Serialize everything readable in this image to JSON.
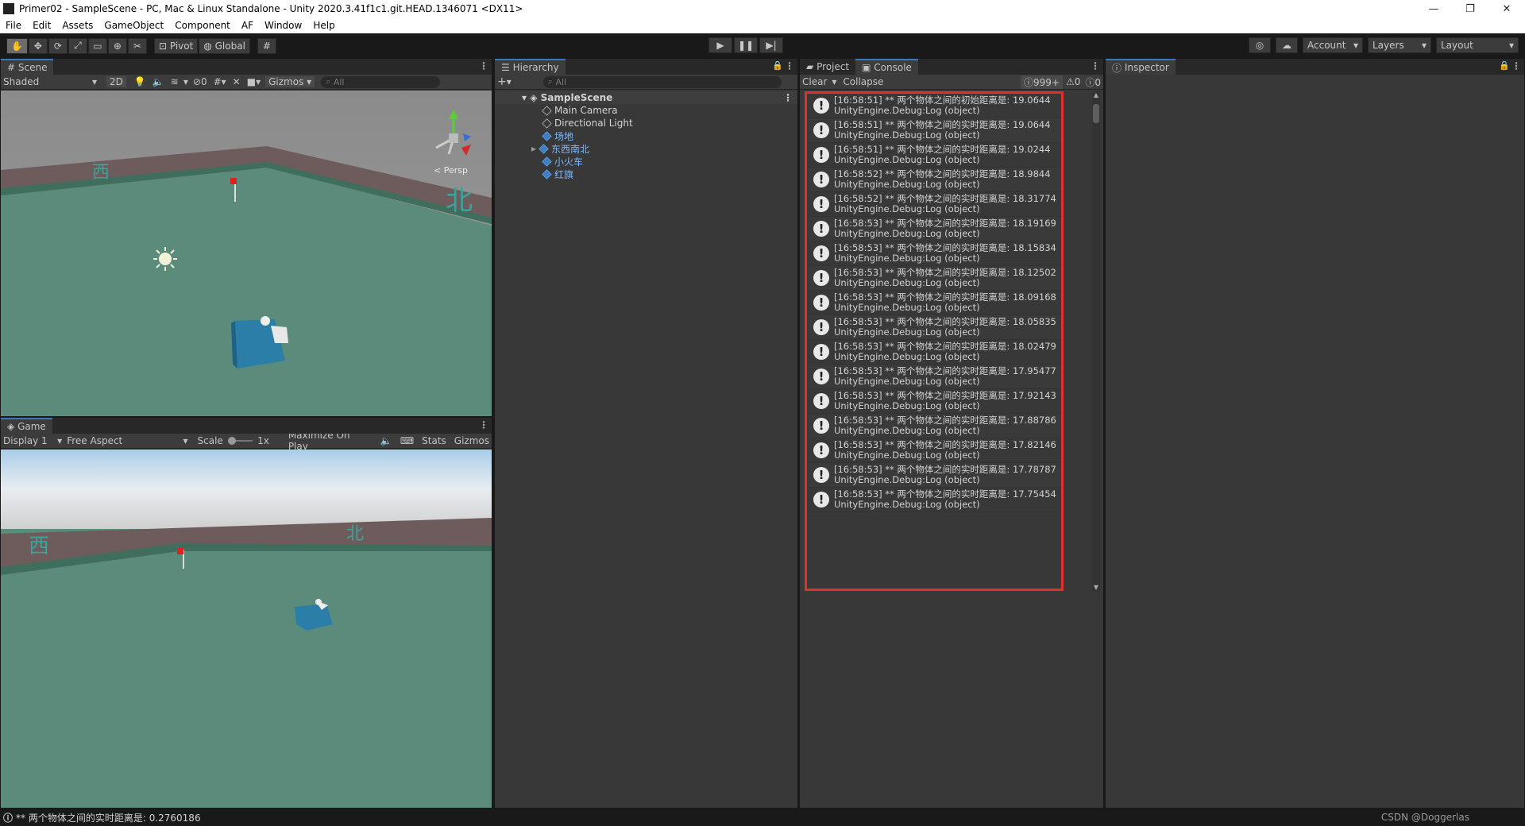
{
  "window": {
    "title": "Primer02 - SampleScene - PC, Mac & Linux Standalone - Unity 2020.3.41f1c1.git.HEAD.1346071 <DX11>",
    "minimize": "—",
    "maximize": "❐",
    "close": "✕"
  },
  "menu": [
    "File",
    "Edit",
    "Assets",
    "GameObject",
    "Component",
    "AF",
    "Window",
    "Help"
  ],
  "toolbar": {
    "pivot": "Pivot",
    "global": "Global",
    "account": "Account",
    "layers": "Layers",
    "layout": "Layout",
    "play_icon": "play-icon",
    "pause_icon": "pause-icon",
    "step_icon": "step-icon"
  },
  "scene": {
    "tab": "Scene",
    "shading": "Shaded",
    "mode_2d": "2D",
    "hidden_count": "0",
    "gizmos": "Gizmos",
    "search_placeholder": "All",
    "persp": "< Persp",
    "label_west": "西",
    "label_north": "北"
  },
  "game": {
    "tab": "Game",
    "display": "Display 1",
    "aspect": "Free Aspect",
    "scale_label": "Scale",
    "scale_value": "1x",
    "maximize": "Maximize On Play",
    "stats": "Stats",
    "gizmos": "Gizmos",
    "label_west": "西",
    "label_north": "北"
  },
  "hierarchy": {
    "tab": "Hierarchy",
    "search_placeholder": "All",
    "scene": "SampleScene",
    "items": [
      {
        "label": "Main Camera",
        "prefab": false
      },
      {
        "label": "Directional Light",
        "prefab": false
      },
      {
        "label": "场地",
        "prefab": true
      },
      {
        "label": "东西南北",
        "prefab": true
      },
      {
        "label": "小火车",
        "prefab": true
      },
      {
        "label": "红旗",
        "prefab": true
      }
    ]
  },
  "console": {
    "project_tab": "Project",
    "console_tab": "Console",
    "clear": "Clear",
    "collapse": "Collapse",
    "log_count": "999+",
    "warn_count": "0",
    "error_count": "0",
    "entries": [
      {
        "line1": "[16:58:51] ** 两个物体之间的初始距离是: 19.0644",
        "line2": "UnityEngine.Debug:Log (object)"
      },
      {
        "line1": "[16:58:51] ** 两个物体之间的实时距离是: 19.0644",
        "line2": "UnityEngine.Debug:Log (object)"
      },
      {
        "line1": "[16:58:51] ** 两个物体之间的实时距离是: 19.0244",
        "line2": "UnityEngine.Debug:Log (object)"
      },
      {
        "line1": "[16:58:52] ** 两个物体之间的实时距离是: 18.9844",
        "line2": "UnityEngine.Debug:Log (object)"
      },
      {
        "line1": "[16:58:52] ** 两个物体之间的实时距离是: 18.31774",
        "line2": "UnityEngine.Debug:Log (object)"
      },
      {
        "line1": "[16:58:53] ** 两个物体之间的实时距离是: 18.19169",
        "line2": "UnityEngine.Debug:Log (object)"
      },
      {
        "line1": "[16:58:53] ** 两个物体之间的实时距离是: 18.15834",
        "line2": "UnityEngine.Debug:Log (object)"
      },
      {
        "line1": "[16:58:53] ** 两个物体之间的实时距离是: 18.12502",
        "line2": "UnityEngine.Debug:Log (object)"
      },
      {
        "line1": "[16:58:53] ** 两个物体之间的实时距离是: 18.09168",
        "line2": "UnityEngine.Debug:Log (object)"
      },
      {
        "line1": "[16:58:53] ** 两个物体之间的实时距离是: 18.05835",
        "line2": "UnityEngine.Debug:Log (object)"
      },
      {
        "line1": "[16:58:53] ** 两个物体之间的实时距离是: 18.02479",
        "line2": "UnityEngine.Debug:Log (object)"
      },
      {
        "line1": "[16:58:53] ** 两个物体之间的实时距离是: 17.95477",
        "line2": "UnityEngine.Debug:Log (object)"
      },
      {
        "line1": "[16:58:53] ** 两个物体之间的实时距离是: 17.92143",
        "line2": "UnityEngine.Debug:Log (object)"
      },
      {
        "line1": "[16:58:53] ** 两个物体之间的实时距离是: 17.88786",
        "line2": "UnityEngine.Debug:Log (object)"
      },
      {
        "line1": "[16:58:53] ** 两个物体之间的实时距离是: 17.82146",
        "line2": "UnityEngine.Debug:Log (object)"
      },
      {
        "line1": "[16:58:53] ** 两个物体之间的实时距离是: 17.78787",
        "line2": "UnityEngine.Debug:Log (object)"
      },
      {
        "line1": "[16:58:53] ** 两个物体之间的实时距离是: 17.75454",
        "line2": "UnityEngine.Debug:Log (object)"
      }
    ],
    "highlight_color": "#e03030"
  },
  "inspector": {
    "tab": "Inspector"
  },
  "status": {
    "message": "** 两个物体之间的实时距离是: 0.2760186",
    "watermark": "CSDN @Doggerlas"
  }
}
